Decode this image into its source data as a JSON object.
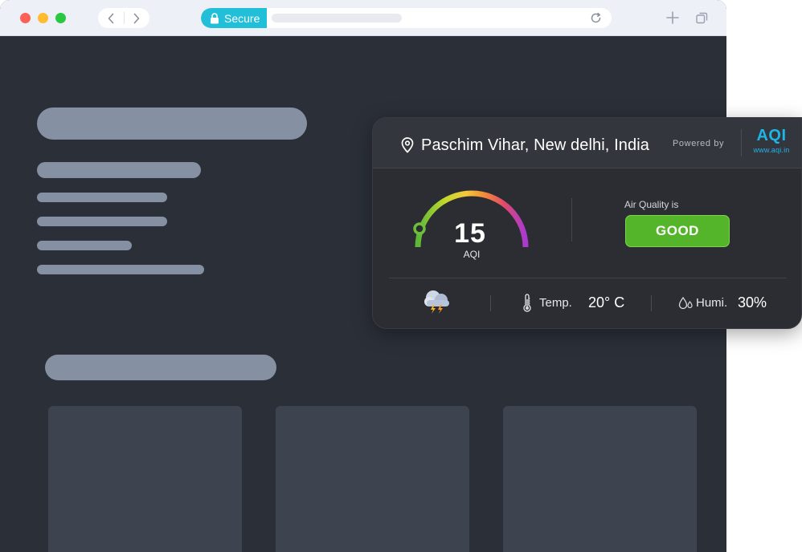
{
  "browser": {
    "secure_label": "Secure"
  },
  "widget": {
    "location": "Paschim Vihar, New delhi, India",
    "powered_by": "Powered by",
    "brand_logo": "AQI",
    "brand_url": "www.aqi.in",
    "aqi_value": "15",
    "aqi_label": "AQI",
    "air_quality_caption": "Air Quality is",
    "air_quality_status": "GOOD",
    "temp_label": "Temp.",
    "temp_value": "20° C",
    "humidity_label": "Humi.",
    "humidity_value": "30%",
    "weather_icon": "thunderstorm-cloud-icon",
    "colors": {
      "status_good": "#55b52a",
      "brand": "#1fb4e6",
      "secure": "#22bfd8"
    }
  }
}
